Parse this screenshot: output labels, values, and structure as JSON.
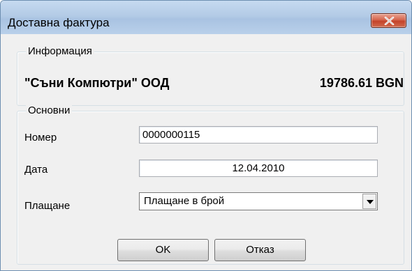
{
  "window": {
    "title": "Доставна фактура",
    "close_icon": "close-icon"
  },
  "info": {
    "legend": "Информация",
    "company": "\"Съни Компютри\" ООД",
    "amount": "19786.61 BGN"
  },
  "main": {
    "legend": "Основни",
    "number_label": "Номер",
    "number_value": "0000000115",
    "date_label": "Дата",
    "date_value": "12.04.2010",
    "payment_label": "Плащане",
    "payment_value": "Плащане в брой",
    "payment_arrow_icon": "chevron-down-icon"
  },
  "buttons": {
    "ok": "OK",
    "cancel": "Отказ"
  },
  "colors": {
    "titlebar": "#b9d1ea",
    "close": "#c75050",
    "dialog_bg": "#f0f0f0"
  }
}
